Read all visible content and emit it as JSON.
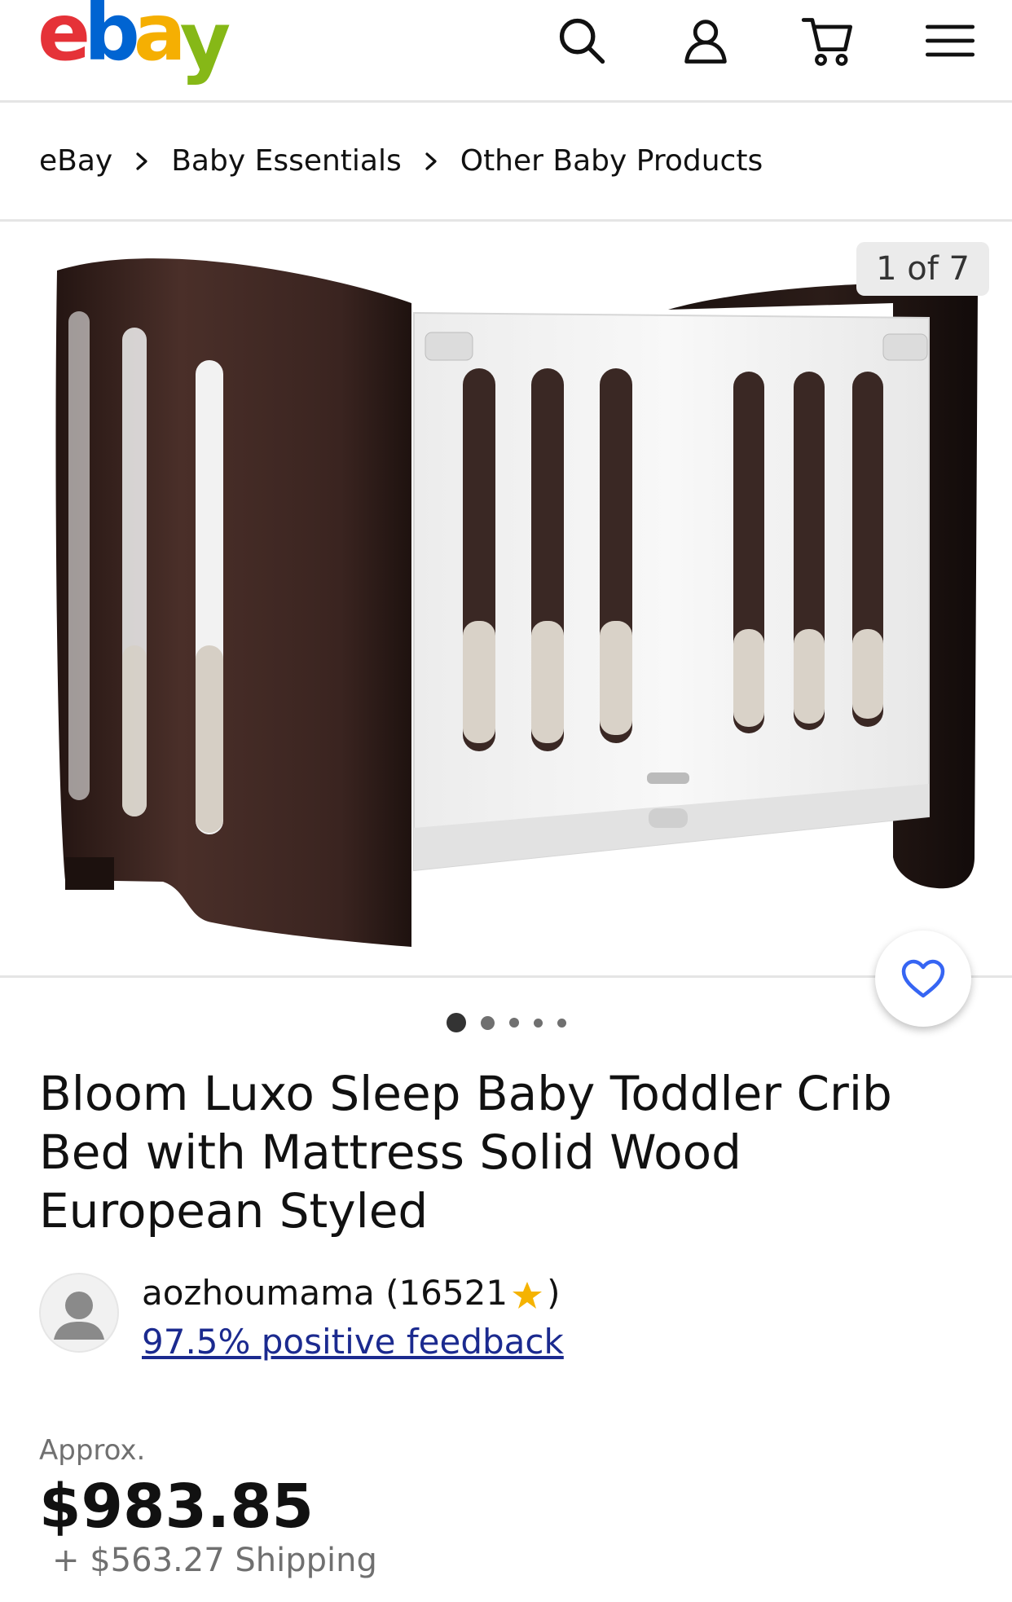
{
  "header": {
    "logo": {
      "letters": [
        "e",
        "b",
        "a",
        "y"
      ],
      "colors": [
        "#e53238",
        "#0064d2",
        "#f5af02",
        "#86b817"
      ]
    },
    "icons": [
      "search-icon",
      "account-icon",
      "cart-icon",
      "menu-icon"
    ]
  },
  "breadcrumb": [
    "eBay",
    "Baby Essentials",
    "Other Baby Products"
  ],
  "gallery": {
    "counter": "1 of 7",
    "dots_count": 5,
    "active_dot": 0
  },
  "listing": {
    "title": "Bloom Luxo Sleep Baby Toddler Crib Bed with Mattress Solid Wood European Styled"
  },
  "seller": {
    "name": "aozhoumama (16521",
    "name_close": ")",
    "feedback": "97.5% positive feedback"
  },
  "price": {
    "approx_label": "Approx.",
    "amount": "$983.85",
    "shipping": "+ $563.27 Shipping"
  },
  "colors": {
    "link": "#1b2a8f",
    "fav_heart": "#3665f3",
    "crib_wood": "#3a2420",
    "crib_white": "#f4f4f4"
  }
}
